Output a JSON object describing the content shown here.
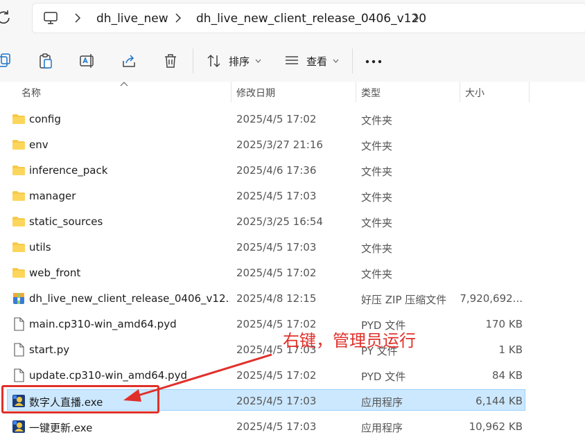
{
  "address_bar": {
    "crumbs": [
      "dh_live_new",
      "dh_live_new_client_release_0406_v120"
    ]
  },
  "toolbar": {
    "sort_label": "排序",
    "view_label": "查看"
  },
  "columns": {
    "name": "名称",
    "modified": "修改日期",
    "type": "类型",
    "size": "大小"
  },
  "rows": [
    {
      "name": "config",
      "modified": "2025/4/5 17:02",
      "type": "文件夹",
      "size": "",
      "icon": "folder-icon"
    },
    {
      "name": "env",
      "modified": "2025/3/27 21:16",
      "type": "文件夹",
      "size": "",
      "icon": "folder-icon"
    },
    {
      "name": "inference_pack",
      "modified": "2025/4/6 17:36",
      "type": "文件夹",
      "size": "",
      "icon": "folder-icon"
    },
    {
      "name": "manager",
      "modified": "2025/4/5 17:03",
      "type": "文件夹",
      "size": "",
      "icon": "folder-icon"
    },
    {
      "name": "static_sources",
      "modified": "2025/3/25 16:54",
      "type": "文件夹",
      "size": "",
      "icon": "folder-icon"
    },
    {
      "name": "utils",
      "modified": "2025/4/5 17:03",
      "type": "文件夹",
      "size": "",
      "icon": "folder-icon"
    },
    {
      "name": "web_front",
      "modified": "2025/4/5 17:02",
      "type": "文件夹",
      "size": "",
      "icon": "folder-icon"
    },
    {
      "name": "dh_live_new_client_release_0406_v12...",
      "modified": "2025/4/8 12:15",
      "type": "好压 ZIP 压缩文件",
      "size": "7,920,692...",
      "icon": "zip-archive-icon"
    },
    {
      "name": "main.cp310-win_amd64.pyd",
      "modified": "2025/4/5 17:02",
      "type": "PYD 文件",
      "size": "170 KB",
      "icon": "file-icon"
    },
    {
      "name": "start.py",
      "modified": "2025/4/5 17:03",
      "type": "PY 文件",
      "size": "1 KB",
      "icon": "file-icon"
    },
    {
      "name": "update.cp310-win_amd64.pyd",
      "modified": "2025/4/5 17:02",
      "type": "PYD 文件",
      "size": "84 KB",
      "icon": "file-icon"
    },
    {
      "name": "数字人直播.exe",
      "modified": "2025/4/5 17:03",
      "type": "应用程序",
      "size": "6,144 KB",
      "icon": "app-exe-icon",
      "selected": true
    },
    {
      "name": "一键更新.exe",
      "modified": "2025/4/5 17:03",
      "type": "应用程序",
      "size": "10,962 KB",
      "icon": "app-exe-icon"
    }
  ],
  "annotation": {
    "text": "右键，管理员运行",
    "color": "#e0302a"
  }
}
